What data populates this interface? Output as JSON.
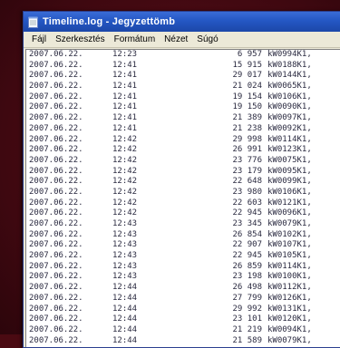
{
  "window": {
    "title": "Timeline.log - Jegyzettömb",
    "icon": "notepad-icon"
  },
  "menu": [
    "Fájl",
    "Szerkesztés",
    "Formátum",
    "Nézet",
    "Súgó"
  ],
  "log_rows": [
    {
      "date": "2007.06.22.",
      "time": "12:23",
      "num": "6 957",
      "value": "kW0994K1,"
    },
    {
      "date": "2007.06.22.",
      "time": "12:41",
      "num": "15 915",
      "value": "kW0188K1,"
    },
    {
      "date": "2007.06.22.",
      "time": "12:41",
      "num": "29 017",
      "value": "kW0144K1,"
    },
    {
      "date": "2007.06.22.",
      "time": "12:41",
      "num": "21 024",
      "value": "kW0065K1,"
    },
    {
      "date": "2007.06.22.",
      "time": "12:41",
      "num": "19 154",
      "value": "kW0106K1,"
    },
    {
      "date": "2007.06.22.",
      "time": "12:41",
      "num": "19 150",
      "value": "kW0090K1,"
    },
    {
      "date": "2007.06.22.",
      "time": "12:41",
      "num": "21 389",
      "value": "kW0097K1,"
    },
    {
      "date": "2007.06.22.",
      "time": "12:41",
      "num": "21 238",
      "value": "kW0092K1,"
    },
    {
      "date": "2007.06.22.",
      "time": "12:42",
      "num": "29 998",
      "value": "kW0114K1,"
    },
    {
      "date": "2007.06.22.",
      "time": "12:42",
      "num": "26 991",
      "value": "kW0123K1,"
    },
    {
      "date": "2007.06.22.",
      "time": "12:42",
      "num": "23 776",
      "value": "kW0075K1,"
    },
    {
      "date": "2007.06.22.",
      "time": "12:42",
      "num": "23 179",
      "value": "kW0095K1,"
    },
    {
      "date": "2007.06.22.",
      "time": "12:42",
      "num": "22 648",
      "value": "kW0099K1,"
    },
    {
      "date": "2007.06.22.",
      "time": "12:42",
      "num": "23 980",
      "value": "kW0106K1,"
    },
    {
      "date": "2007.06.22.",
      "time": "12:42",
      "num": "22 603",
      "value": "kW0121K1,"
    },
    {
      "date": "2007.06.22.",
      "time": "12:42",
      "num": "22 945",
      "value": "kW0096K1,"
    },
    {
      "date": "2007.06.22.",
      "time": "12:43",
      "num": "23 345",
      "value": "kW0079K1,"
    },
    {
      "date": "2007.06.22.",
      "time": "12:43",
      "num": "26 854",
      "value": "kW0102K1,"
    },
    {
      "date": "2007.06.22.",
      "time": "12:43",
      "num": "22 907",
      "value": "kW0107K1,"
    },
    {
      "date": "2007.06.22.",
      "time": "12:43",
      "num": "22 945",
      "value": "kW0105K1,"
    },
    {
      "date": "2007.06.22.",
      "time": "12:43",
      "num": "26 859",
      "value": "kW0114K1,"
    },
    {
      "date": "2007.06.22.",
      "time": "12:43",
      "num": "23 198",
      "value": "kW0100K1,"
    },
    {
      "date": "2007.06.22.",
      "time": "12:44",
      "num": "26 498",
      "value": "kW0112K1,"
    },
    {
      "date": "2007.06.22.",
      "time": "12:44",
      "num": "27 799",
      "value": "kW0126K1,"
    },
    {
      "date": "2007.06.22.",
      "time": "12:44",
      "num": "29 992",
      "value": "kW0131K1,"
    },
    {
      "date": "2007.06.22.",
      "time": "12:44",
      "num": "23 101",
      "value": "kW0120K1,"
    },
    {
      "date": "2007.06.22.",
      "time": "12:44",
      "num": "21 219",
      "value": "kW0094K1,"
    },
    {
      "date": "2007.06.22.",
      "time": "12:44",
      "num": "21 589",
      "value": "kW0079K1,"
    }
  ]
}
